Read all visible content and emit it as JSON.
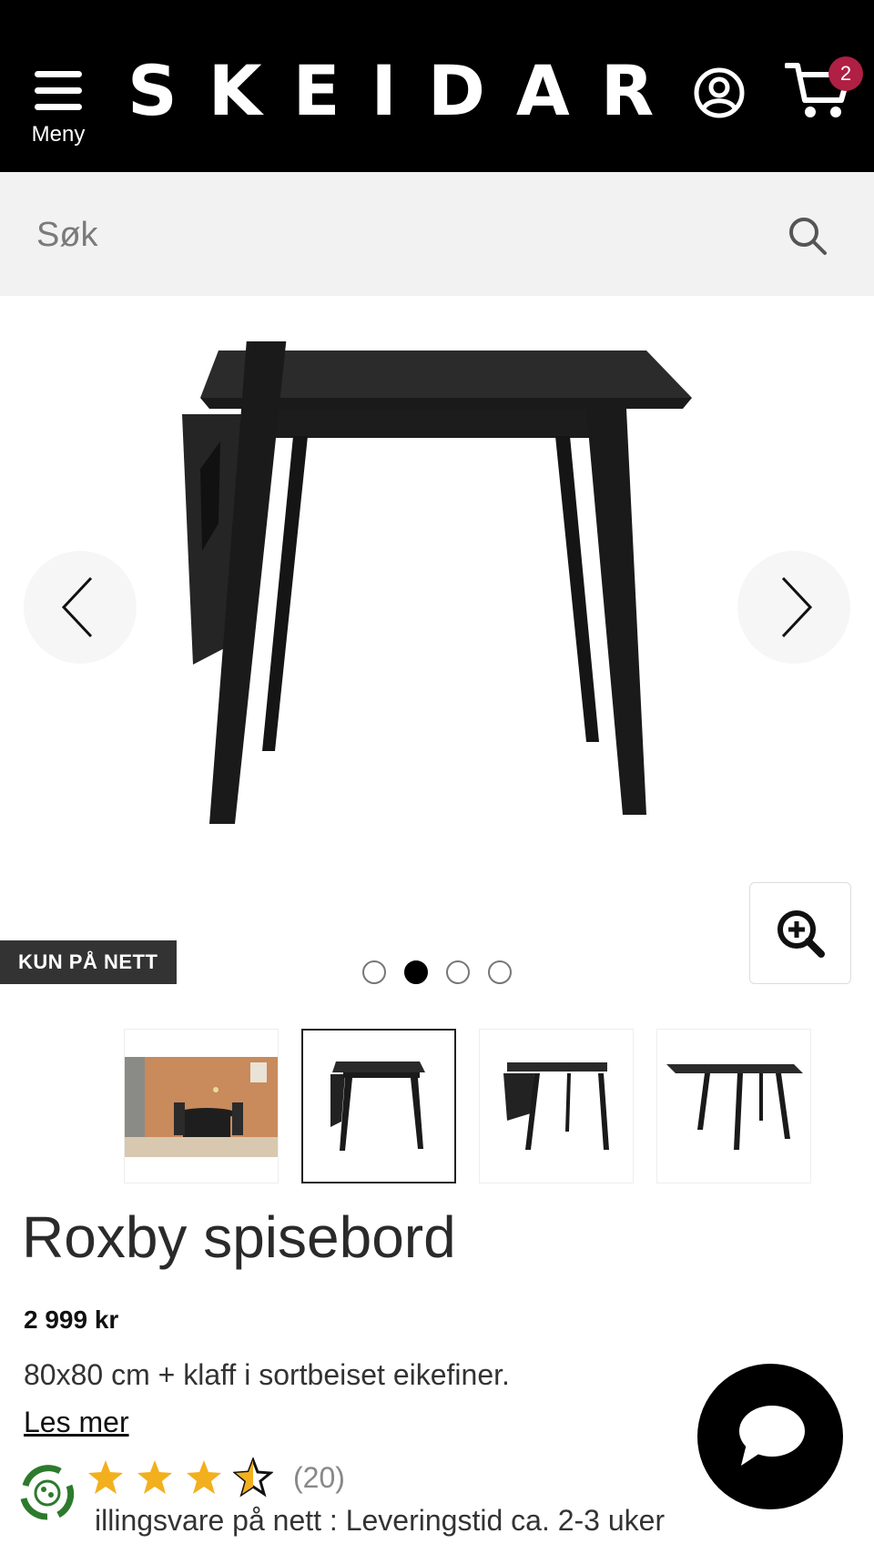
{
  "header": {
    "menu_label": "Meny",
    "logo_text": "SKEIDAR",
    "cart_count": "2",
    "accent_color": "#b01f44"
  },
  "search": {
    "placeholder": "Søk"
  },
  "gallery": {
    "badge": "KUN PÅ NETT",
    "total_images": 4,
    "active_index": 1
  },
  "product": {
    "title": "Roxby spisebord",
    "price": "2 999 kr",
    "description": "80x80 cm + klaff i sortbeiset eikefiner.",
    "read_more": "Les mer",
    "rating": 3.5,
    "rating_count": "(20)",
    "delivery": "illingsvare på nett : Leveringstid ca. 2-3 uker"
  }
}
